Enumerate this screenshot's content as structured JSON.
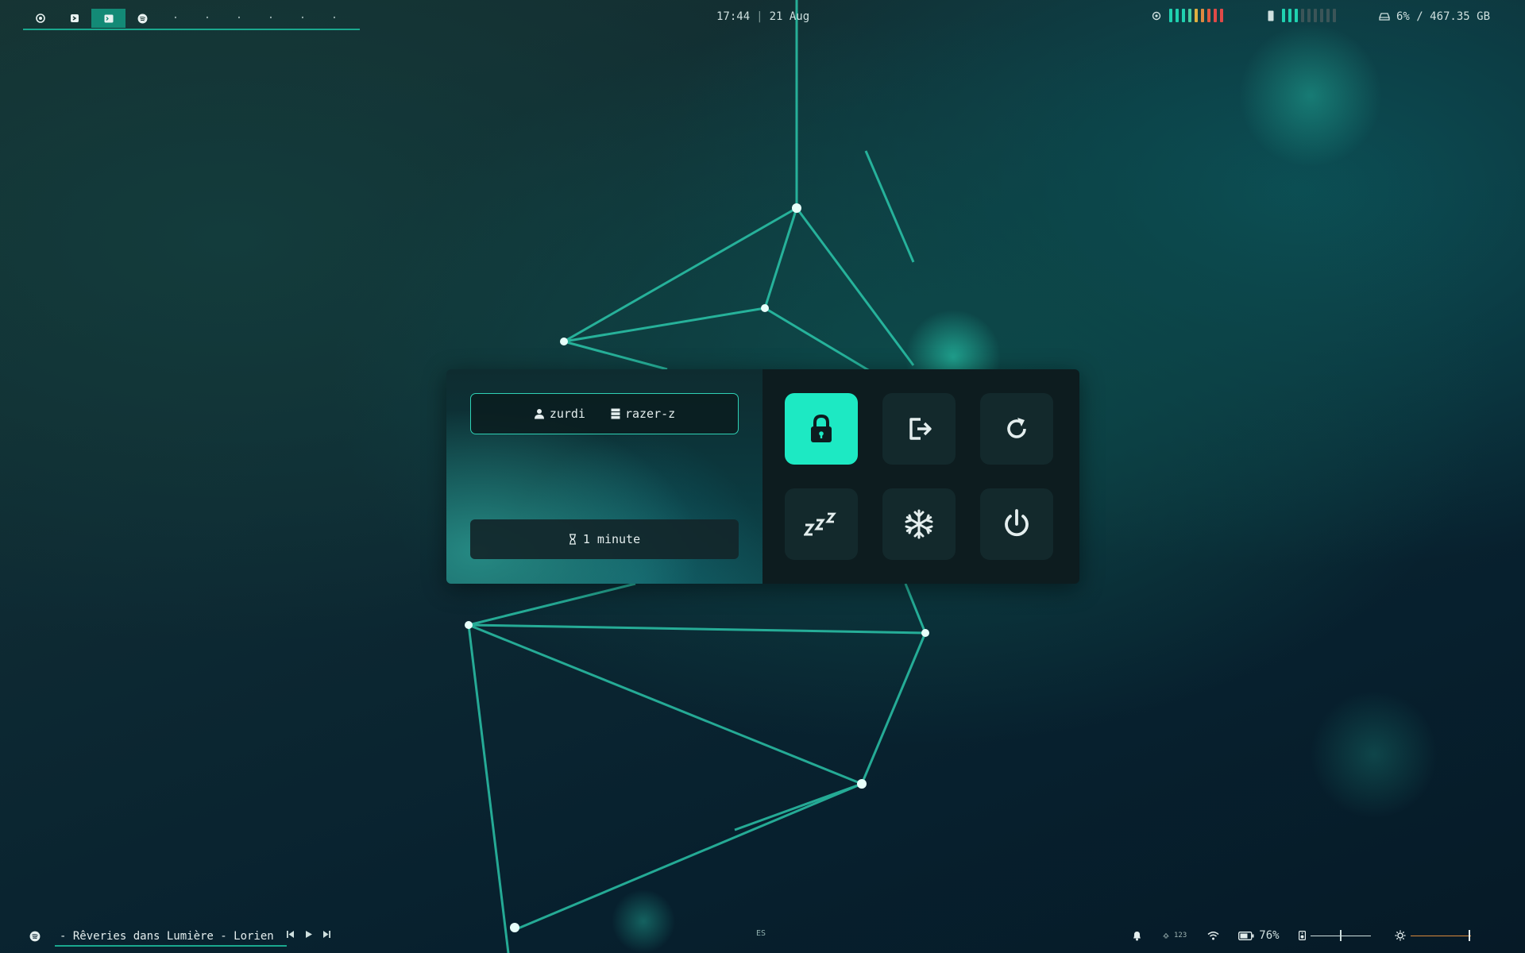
{
  "topbar": {
    "workspaces": [
      {
        "icon": "chrome-icon",
        "active": false
      },
      {
        "icon": "vscode-icon",
        "active": false
      },
      {
        "icon": "terminal-icon",
        "active": true
      },
      {
        "icon": "spotify-icon",
        "active": false
      }
    ],
    "empty_workspaces": [
      "·",
      "·",
      "·",
      "·",
      "·",
      "·"
    ],
    "time": "17:44",
    "separator": "|",
    "date": "21 Aug",
    "cpu": {
      "icon": "cpu-icon",
      "bar_colors": [
        "#1fd1b0",
        "#1fd1b0",
        "#1fd1b0",
        "#46cfa2",
        "#e0b040",
        "#e08a40",
        "#e05a40",
        "#e04a48",
        "#e04a48"
      ]
    },
    "memory": {
      "icon": "memory-icon",
      "bar_colors": [
        "#1fd1b0",
        "#1fd1b0",
        "#1fd1b0",
        "#3b5558",
        "#3b5558",
        "#3b5558",
        "#3b5558",
        "#3b5558",
        "#3b5558"
      ]
    },
    "disk": {
      "icon": "drive-icon",
      "text": "6% / 467.35 GB"
    }
  },
  "power_menu": {
    "user": {
      "icon": "user-icon",
      "name": "zurdi"
    },
    "host": {
      "icon": "server-icon",
      "name": "razer-z"
    },
    "uptime": {
      "icon": "hourglass-icon",
      "text": "1 minute"
    },
    "actions": [
      {
        "id": "lock",
        "icon": "lock-icon",
        "active": true
      },
      {
        "id": "logout",
        "icon": "logout-icon",
        "active": false
      },
      {
        "id": "reboot",
        "icon": "reboot-icon",
        "active": false
      },
      {
        "id": "suspend",
        "icon": "sleep-icon",
        "active": false
      },
      {
        "id": "hibernate",
        "icon": "snowflake-icon",
        "active": false
      },
      {
        "id": "shutdown",
        "icon": "power-icon",
        "active": false
      }
    ]
  },
  "bottombar": {
    "player": {
      "icon": "spotify-icon",
      "track": "- Rêveries dans Lumière - Lorien"
    },
    "media_controls": [
      "previous-icon",
      "play-icon",
      "next-icon"
    ],
    "keyboard_layout": "ES",
    "tray": {
      "notifications_icon": "bell-icon",
      "numlock_text": "123",
      "wifi_icon": "wifi-icon",
      "battery": {
        "icon": "battery-icon",
        "text": "76%"
      },
      "volume": {
        "icon": "speaker-icon",
        "level": 0.5
      },
      "brightness": {
        "icon": "brightness-icon",
        "level": 0.98
      }
    }
  },
  "colors": {
    "accent": "#1de9c3",
    "accent_dark": "#138a76",
    "panel": "#0d1c1f"
  }
}
